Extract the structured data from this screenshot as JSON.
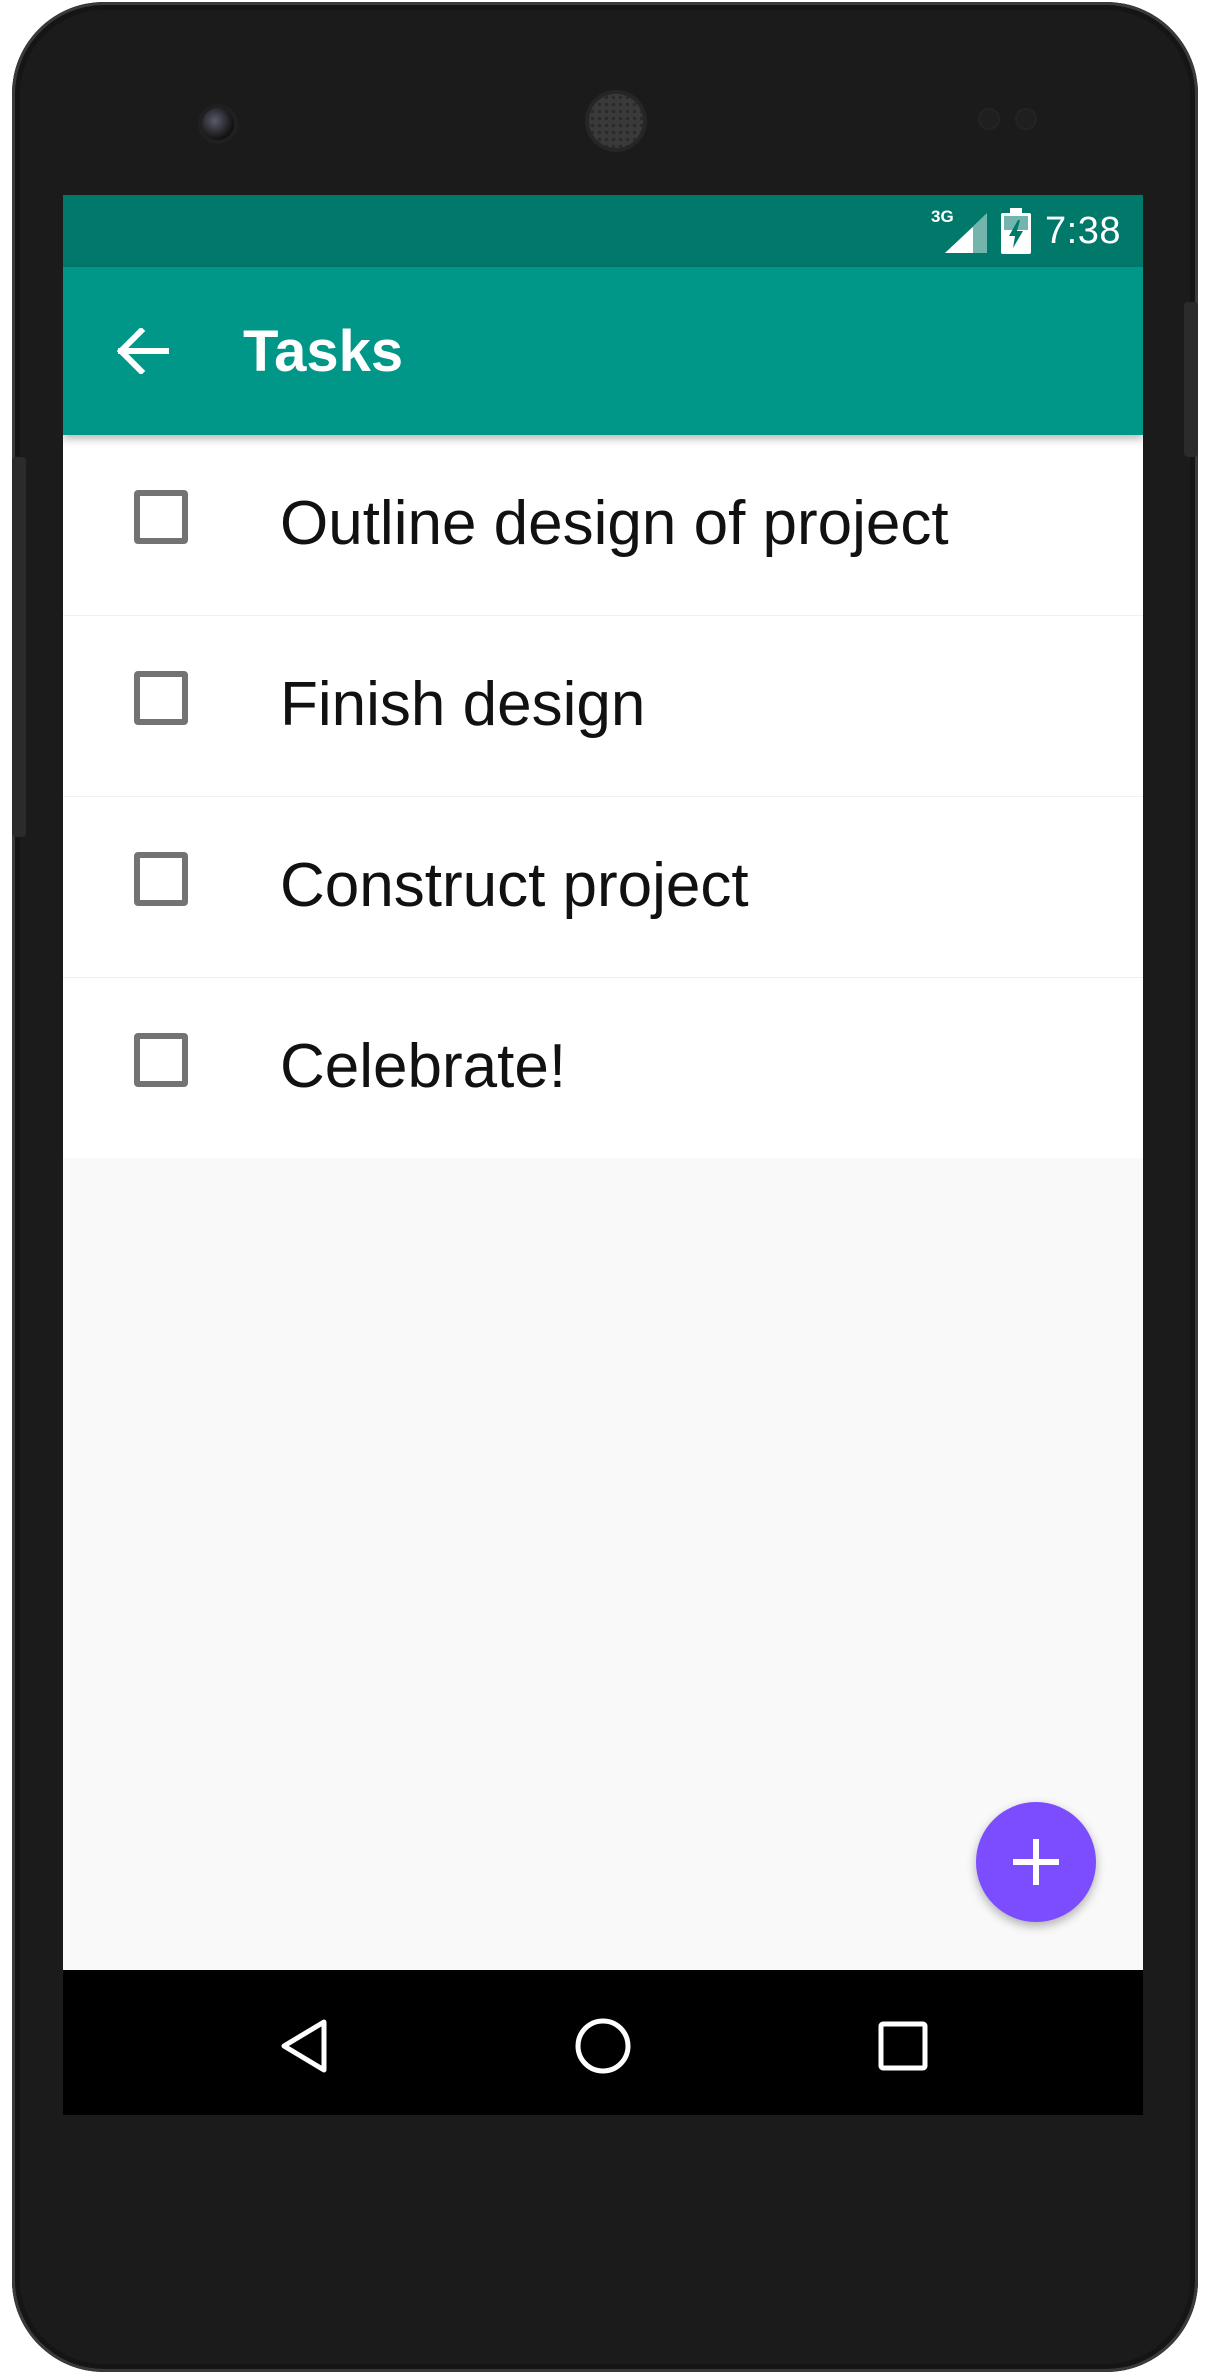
{
  "status_bar": {
    "network_type": "3G",
    "time": "7:38",
    "icons": [
      "signal-icon",
      "battery-charging-icon"
    ]
  },
  "app_bar": {
    "title": "Tasks",
    "back_icon": "arrow-back-icon"
  },
  "tasks": [
    {
      "label": "Outline design of project",
      "checked": false
    },
    {
      "label": "Finish design",
      "checked": false
    },
    {
      "label": "Construct project",
      "checked": false
    },
    {
      "label": "Celebrate!",
      "checked": false
    }
  ],
  "fab": {
    "icon": "plus-icon"
  },
  "nav_bar": {
    "buttons": [
      "back-triangle-icon",
      "home-circle-icon",
      "recents-square-icon"
    ]
  },
  "colors": {
    "status_bar": "#00796b",
    "app_bar": "#009688",
    "fab": "#7c4dff",
    "background": "#f9f9f9"
  }
}
